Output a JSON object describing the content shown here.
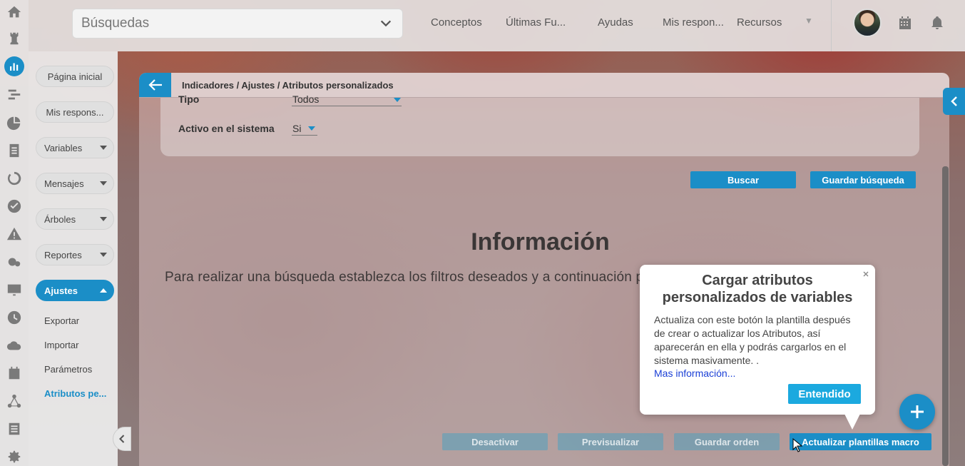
{
  "topbar": {
    "search_placeholder": "Búsquedas",
    "nav": [
      {
        "label": "Conceptos"
      },
      {
        "label": "Últimas Fu..."
      },
      {
        "label": "Ayudas"
      },
      {
        "label": "Mis respon..."
      },
      {
        "label": "Recursos"
      }
    ]
  },
  "menu": {
    "pills": [
      {
        "label": "Página inicial"
      },
      {
        "label": "Mis respons..."
      },
      {
        "label": "Variables"
      },
      {
        "label": "Mensajes"
      },
      {
        "label": "Árboles"
      },
      {
        "label": "Reportes"
      },
      {
        "label": "Ajustes"
      }
    ],
    "sub_items": [
      {
        "label": "Exportar"
      },
      {
        "label": "Importar"
      },
      {
        "label": "Parámetros"
      },
      {
        "label": "Atributos pe..."
      }
    ]
  },
  "panel": {
    "breadcrumb": "Indicadores / Ajustes / Atributos personalizados",
    "filters": {
      "tipo_label": "Tipo",
      "tipo_value": "Todos",
      "activo_label": "Activo en el sistema",
      "activo_value": "Si"
    },
    "buttons": {
      "buscar": "Buscar",
      "guardar_busqueda": "Guardar búsqueda",
      "desactivar": "Desactivar",
      "previsualizar": "Previsualizar",
      "guardar_orden": "Guardar orden",
      "actualizar": "Actualizar plantillas macro"
    },
    "info_title": "Información",
    "info_text": "Para realizar una búsqueda establezca los filtros deseados y a continuación presione el botón Buscar."
  },
  "popover": {
    "title": "Cargar atributos personalizados de variables",
    "body": "Actualiza con este botón la plantilla después de crear o actualizar los Atributos, así aparecerán en ella y podrás cargarlos en el sistema masivamente. .",
    "link": "Mas información...",
    "button": "Entendido"
  },
  "colors": {
    "accent": "#1b8ec7",
    "popover_button": "#1ba9df",
    "link": "#1a3fd6"
  }
}
